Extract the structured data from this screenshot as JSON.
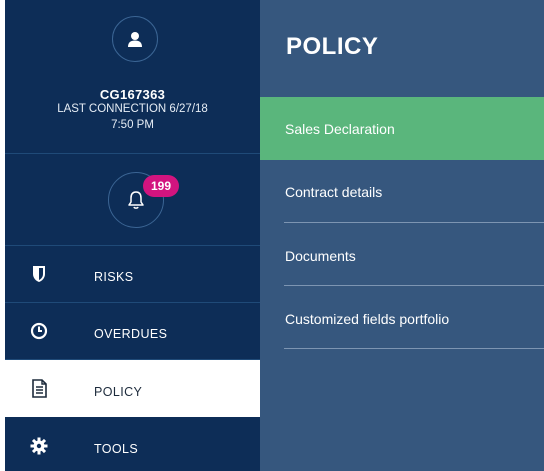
{
  "profile": {
    "icon": "user-icon",
    "user_id": "CG167363",
    "last_connection": "LAST CONNECTION 6/27/18",
    "last_connection_time": "7:50 PM"
  },
  "notifications": {
    "icon": "bell-icon",
    "count": "199",
    "badge_color": "#d2147f"
  },
  "nav": {
    "items": [
      {
        "label": "RISKS",
        "icon": "shield-icon"
      },
      {
        "label": "OVERDUES",
        "icon": "clock-icon"
      },
      {
        "label": "POLICY",
        "icon": "document-icon",
        "active": true
      },
      {
        "label": "TOOLS",
        "icon": "gear-icon"
      }
    ]
  },
  "panel": {
    "title": "POLICY",
    "items": [
      {
        "label": "Sales Declaration",
        "active": true
      },
      {
        "label": "Contract details"
      },
      {
        "label": "Documents"
      },
      {
        "label": "Customized fields portfolio"
      }
    ]
  },
  "colors": {
    "sidebar_bg": "#0d2d57",
    "panel_bg": "#36577e",
    "active_green": "#5ab67c"
  }
}
